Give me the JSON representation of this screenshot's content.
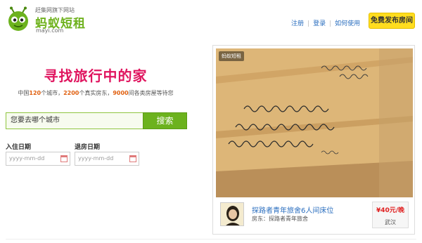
{
  "logo": {
    "tagline": "赶集网旗下网站",
    "name": "蚂蚁短租",
    "domain": "mayi.com"
  },
  "nav": {
    "links": [
      "注册",
      "登录",
      "如何使用"
    ],
    "publish_label": "免费发布房间"
  },
  "hero": {
    "title": "寻找旅行中的家",
    "stats": {
      "prefix": "中国",
      "cities": "120",
      "cities_label": "个城市，",
      "hosts": "2200",
      "hosts_label": "个真实房东，",
      "rooms": "9000",
      "rooms_label": "间各类房屋等待您"
    }
  },
  "search": {
    "placeholder": "您要去哪个城市",
    "button_label": "搜索"
  },
  "dates": {
    "checkin_label": "入住日期",
    "checkout_label": "退房日期",
    "checkin_placeholder": "yyyy-mm-dd",
    "checkout_placeholder": "yyyy-mm-dd"
  },
  "listing": {
    "photo_brand": "蚂蚁短租",
    "title": "探路者青年旅舍6人间床位",
    "host": "房东：探路者青年旅舍",
    "price": "¥40元/晚",
    "city": "武汉"
  },
  "colors": {
    "brand_green": "#6cb21e",
    "title_pink": "#e0155f",
    "link_blue": "#2a6ebf",
    "publish_yellow": "#ffdd1f",
    "price_red": "#e02020"
  }
}
